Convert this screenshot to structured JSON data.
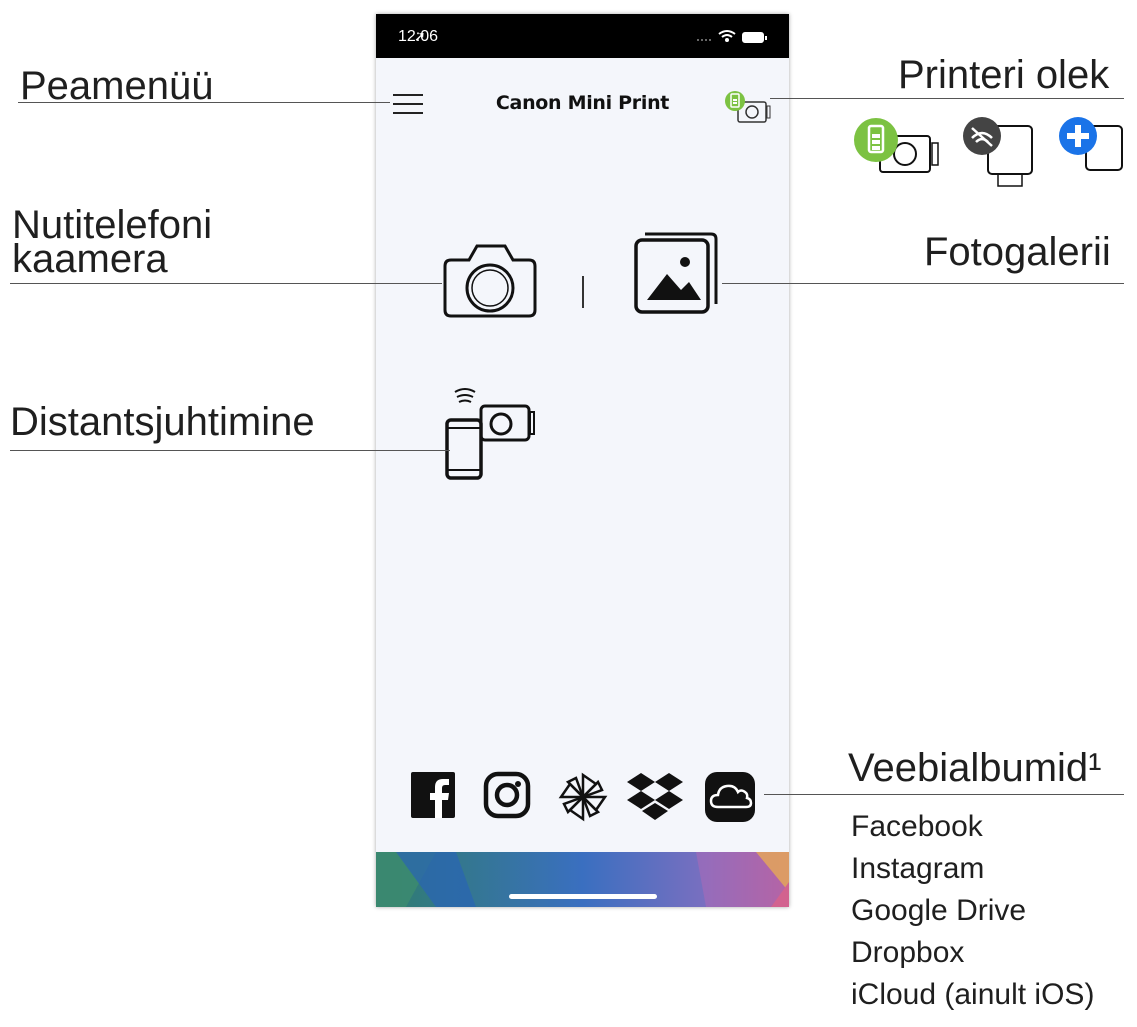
{
  "labels": {
    "main_menu": "Peamenüü",
    "printer_status": "Printeri olek",
    "camera_line1": "Nutitelefoni",
    "camera_line2": "kaamera",
    "gallery": "Fotogalerii",
    "remote": "Distantsjuhtimine",
    "albums": "Veebialbumid¹"
  },
  "albums_list": [
    "Facebook",
    "Instagram",
    "Google Drive",
    "Dropbox",
    "iCloud (ainult iOS)"
  ],
  "phone": {
    "time": "12:06",
    "title": "Canon Mini Print",
    "social_icons": [
      "facebook-icon",
      "instagram-icon",
      "google-drive-icon",
      "dropbox-icon",
      "icloud-icon"
    ]
  },
  "colors": {
    "battery_green": "#7cc242",
    "disconnected_gray": "#444444",
    "add_blue": "#1a73e8",
    "footer_gradient": [
      "#2f7d6c",
      "#3a6fc0",
      "#c95a8a",
      "#e3a45a"
    ]
  }
}
